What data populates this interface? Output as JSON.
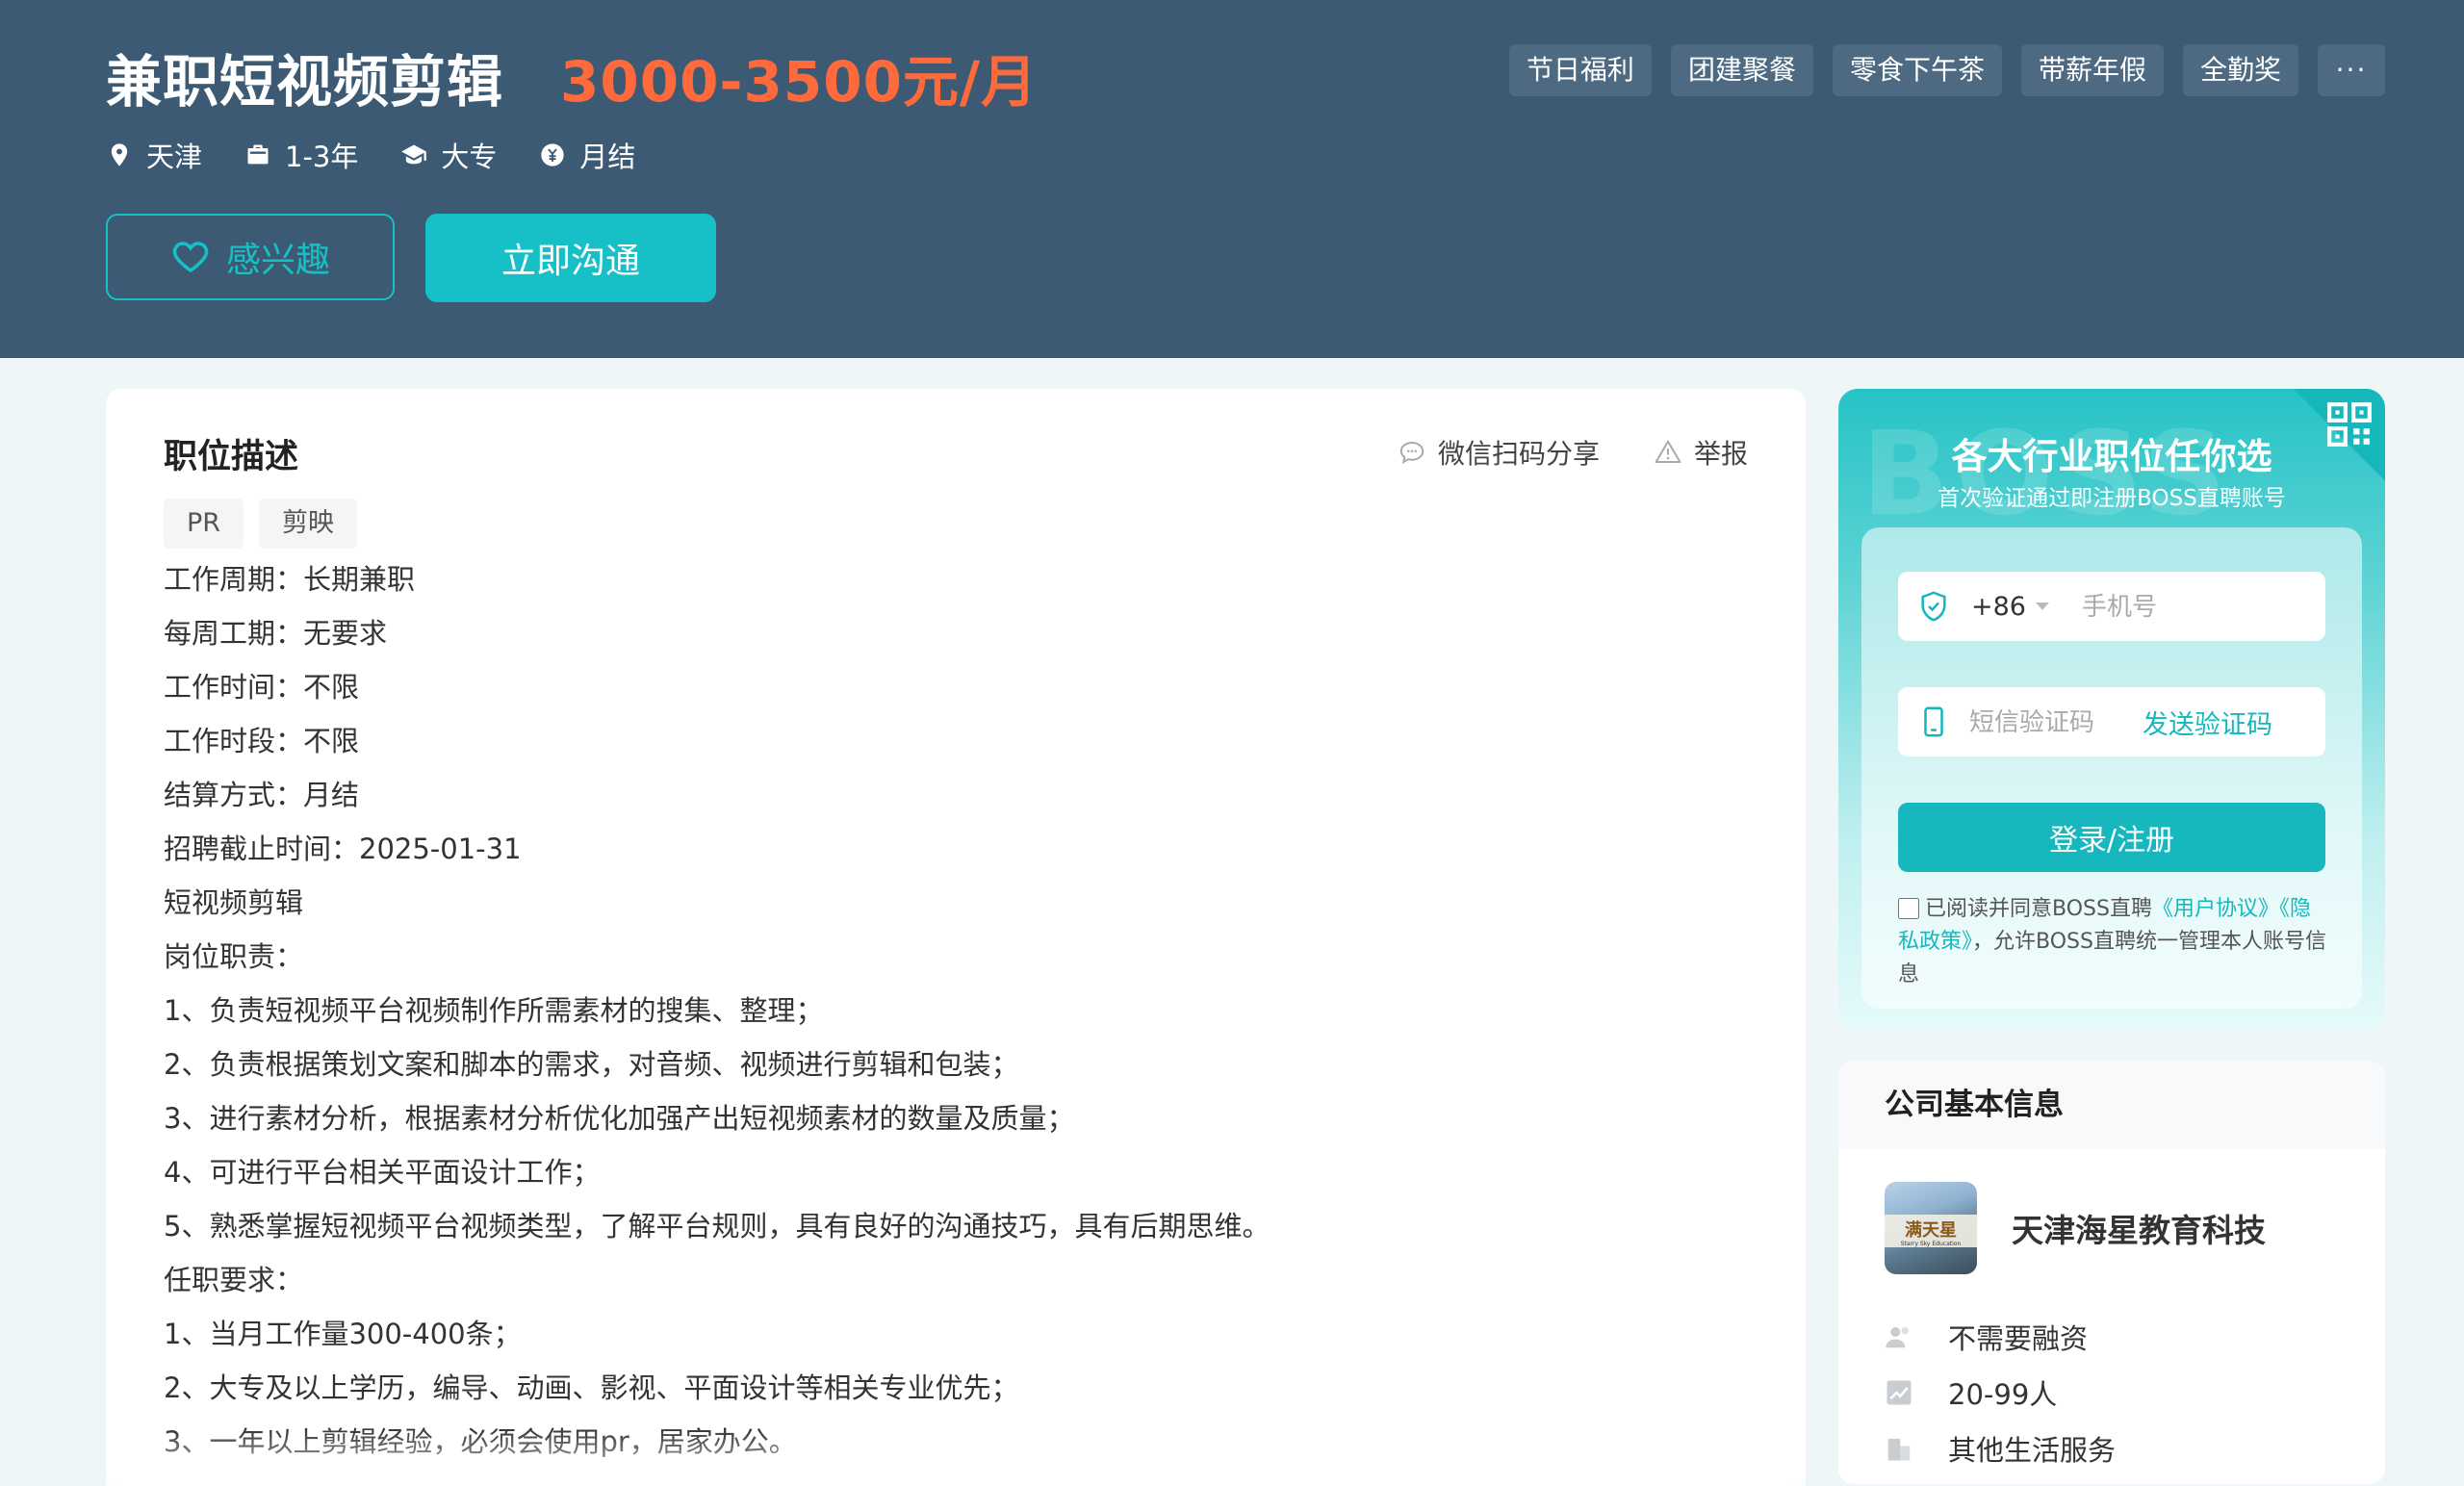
{
  "job": {
    "title": "兼职短视频剪辑",
    "salary": "3000-3500元/月",
    "benefits": [
      "节日福利",
      "团建聚餐",
      "零食下午茶",
      "带薪年假",
      "全勤奖"
    ],
    "benefits_more": "···",
    "meta": {
      "city": "天津",
      "experience": "1-3年",
      "education": "大专",
      "pay_cycle": "月结"
    },
    "interest_label": "感兴趣",
    "chat_label": "立即沟通"
  },
  "description": {
    "title": "职位描述",
    "share_label": "微信扫码分享",
    "report_label": "举报",
    "skills": [
      "PR",
      "剪映"
    ],
    "lines": [
      "工作周期：长期兼职",
      "每周工期：无要求",
      "工作时间：不限",
      "工作时段：不限",
      "结算方式：月结",
      "招聘截止时间：2025-01-31",
      "短视频剪辑",
      "岗位职责：",
      "1、负责短视频平台视频制作所需素材的搜集、整理；",
      "2、负责根据策划文案和脚本的需求，对音频、视频进行剪辑和包装；",
      "3、进行素材分析，根据素材分析优化加强产出短视频素材的数量及质量；",
      "4、可进行平台相关平面设计工作；",
      "5、熟悉掌握短视频平台视频类型，了解平台规则，具有良好的沟通技巧，具有后期思维。",
      "任职要求：",
      "1、当月工作量300-400条；",
      "2、大专及以上学历，编导、动画、影视、平面设计等相关专业优先；",
      "3、一年以上剪辑经验，必须会使用pr，居家办公。"
    ]
  },
  "signup": {
    "watermark": "BOSS",
    "headline": "各大行业职位任你选",
    "subline": "首次验证通过即注册BOSS直聘账号",
    "country_code": "+86",
    "phone_placeholder": "手机号",
    "code_placeholder": "短信验证码",
    "send_code_label": "发送验证码",
    "login_label": "登录/注册",
    "agree_prefix": "已阅读并同意BOSS直聘",
    "agree_link1": "《用户协议》",
    "agree_link2": "《隐私政策》",
    "agree_suffix": "，允许BOSS直聘统一管理本人账号信息"
  },
  "company": {
    "section_title": "公司基本信息",
    "name": "天津海星教育科技",
    "financing": "不需要融资",
    "size": "20-99人",
    "industry": "其他生活服务",
    "logo_text": "满天星",
    "logo_subtext": "Starry Sky Education"
  },
  "colors": {
    "header_bg": "#3c5a73",
    "salary": "#ff6a3d",
    "accent": "#16c0c6",
    "page_bg": "#eef6f8"
  }
}
